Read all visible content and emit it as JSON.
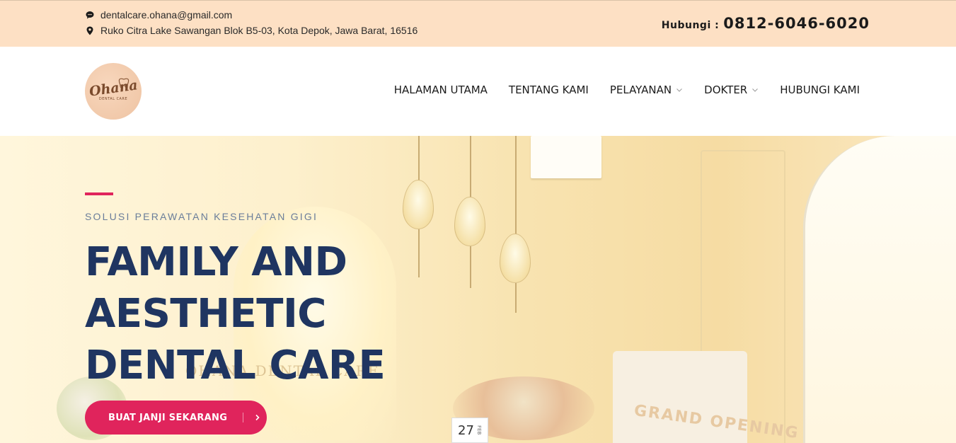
{
  "topbar": {
    "email": "dentalcare.ohana@gmail.com",
    "address": "Ruko Citra Lake Sawangan Blok B5-03, Kota Depok, Jawa Barat, 16516",
    "phone_label": "Hubungi :",
    "phone_number": "0812-6046-6020",
    "icons": {
      "email": "chat-bubble-icon",
      "address": "map-pin-icon"
    }
  },
  "logo": {
    "word": "Ohana",
    "sub": "DENTAL CARE"
  },
  "nav": {
    "items": [
      {
        "label": "HALAMAN UTAMA",
        "dropdown": false
      },
      {
        "label": "TENTANG KAMI",
        "dropdown": false
      },
      {
        "label": "PELAYANAN",
        "dropdown": true
      },
      {
        "label": "DOKTER",
        "dropdown": true
      },
      {
        "label": "HUBUNGI KAMI",
        "dropdown": false
      }
    ]
  },
  "hero": {
    "eyebrow": "SOLUSI PERAWATAN KESEHATAN GIGI",
    "headline": "FAMILY AND AESTHETIC DENTAL CARE",
    "cta_label": "BUAT JANJI SEKARANG",
    "photo_text": {
      "signage": "OHANA DENTAL CARE",
      "box_text": "GRAND OPENING",
      "calendar_day": "27",
      "calendar_month": "FEB"
    }
  },
  "colors": {
    "topbar_bg": "#fde0c4",
    "accent": "#e0245c",
    "headline": "#1f3561",
    "eyebrow": "#6a7d9a"
  }
}
